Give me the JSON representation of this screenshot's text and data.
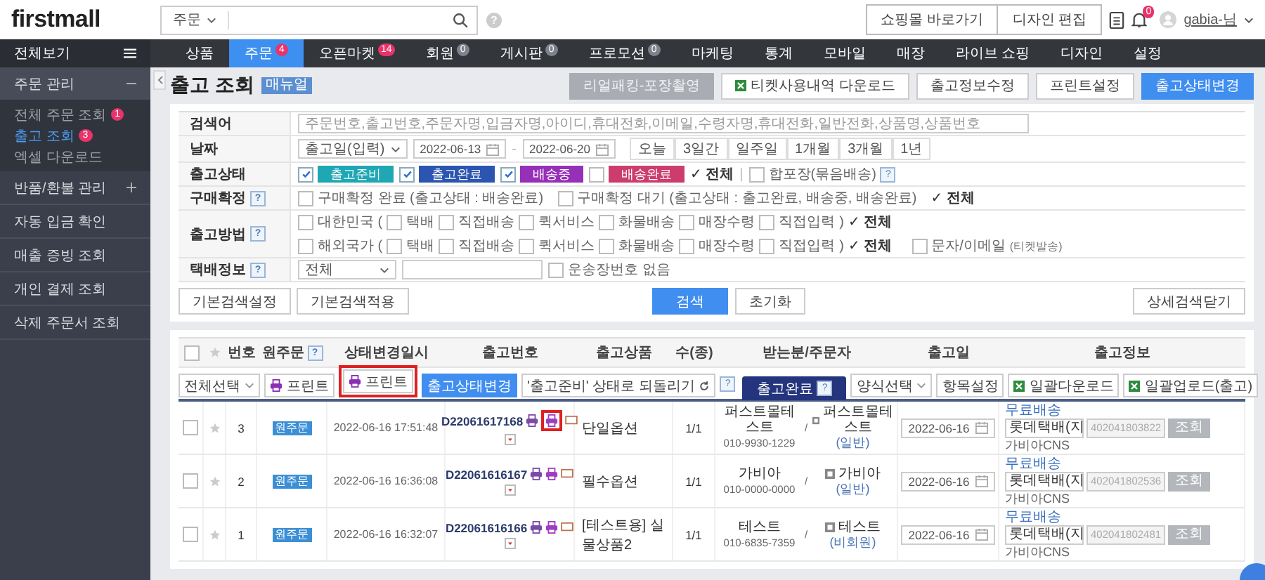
{
  "header": {
    "logo": "firstmall",
    "search_scope": "주문",
    "search_help": "?",
    "links": [
      "쇼핑몰 바로가기",
      "디자인 편집"
    ],
    "notification_count": "0",
    "user": "gabia-님"
  },
  "nav": {
    "all_menu": "전체보기",
    "tabs": [
      {
        "label": "상품",
        "selected": false
      },
      {
        "label": "주문",
        "selected": true,
        "badge": {
          "text": "4",
          "color": "#e8336b"
        }
      },
      {
        "label": "오픈마켓",
        "selected": false,
        "badge": {
          "text": "14",
          "color": "#e8336b"
        }
      },
      {
        "label": "회원",
        "selected": false,
        "badge": {
          "text": "0",
          "color": "#7d828c"
        }
      },
      {
        "label": "게시판",
        "selected": false,
        "badge": {
          "text": "0",
          "color": "#7d828c"
        }
      },
      {
        "label": "프로모션",
        "selected": false,
        "badge": {
          "text": "0",
          "color": "#7d828c"
        }
      },
      {
        "label": "마케팅",
        "selected": false
      },
      {
        "label": "통계",
        "selected": false
      },
      {
        "label": "모바일",
        "selected": false
      },
      {
        "label": "매장",
        "selected": false
      },
      {
        "label": "라이브 쇼핑",
        "selected": false
      },
      {
        "label": "디자인",
        "selected": false
      },
      {
        "label": "설정",
        "selected": false
      }
    ]
  },
  "sidebar": {
    "sections": [
      {
        "kind": "group",
        "label": "주문 관리",
        "expanded": true,
        "children": [
          {
            "label": "전체 주문 조회",
            "badge": "1",
            "selected": false
          },
          {
            "label": "출고 조회",
            "badge": "3",
            "selected": true
          },
          {
            "label": "엑셀 다운로드",
            "selected": false
          }
        ]
      },
      {
        "kind": "group",
        "label": "반품/환불 관리",
        "expanded": false
      },
      {
        "kind": "link",
        "label": "자동 입금 확인"
      },
      {
        "kind": "link",
        "label": "매출 증빙 조회"
      },
      {
        "kind": "link",
        "label": "개인 결제 조회"
      },
      {
        "kind": "link",
        "label": "삭제 주문서 조회"
      }
    ]
  },
  "page": {
    "title": "출고 조회",
    "manual_badge": "매뉴얼",
    "actions": [
      {
        "label": "리얼패킹-포장촬영",
        "kind": "muted"
      },
      {
        "label": "티켓사용내역 다운로드",
        "kind": "excel"
      },
      {
        "label": "출고정보수정",
        "kind": "plain"
      },
      {
        "label": "프린트설정",
        "kind": "plain"
      },
      {
        "label": "출고상태변경",
        "kind": "primary"
      }
    ]
  },
  "search": {
    "rows": [
      {
        "kind": "keyword",
        "label": "검색어",
        "placeholder": "주문번호,출고번호,주문자명,입금자명,아이디,휴대전화,이메일,수령자명,휴대전화,일반전화,상품명,상품번호"
      },
      {
        "kind": "date",
        "label": "날짜",
        "date_type": "출고일(입력)",
        "from": "2022-06-13",
        "separator": "-",
        "to": "2022-06-20",
        "ranges": [
          "오늘",
          "3일간",
          "일주일",
          "1개월",
          "3개월",
          "1년"
        ]
      },
      {
        "kind": "status",
        "label": "출고상태",
        "statuses": [
          {
            "label": "출고준비",
            "checked": true,
            "color": "#1fa7b4"
          },
          {
            "label": "출고완료",
            "checked": true,
            "color": "#2b55b0"
          },
          {
            "label": "배송중",
            "checked": true,
            "color": "#9630b8"
          },
          {
            "label": "배송완료",
            "checked": false,
            "color": "#cc3d6e"
          }
        ],
        "all": "✓ 전체",
        "separator": "|",
        "bundle": {
          "label": "합포장(묶음배송)",
          "checked": false,
          "help": "?"
        }
      },
      {
        "kind": "options",
        "label": "구매확정",
        "help": "?",
        "options": [
          {
            "label": "구매확정 완료 (출고상태 : 배송완료)",
            "checked": false
          },
          {
            "label": "구매확정 대기 (출고상태 : 출고완료, 배송중, 배송완료)",
            "checked": false
          }
        ],
        "all": "✓ 전체"
      },
      {
        "kind": "method",
        "label": "출고방법",
        "help": "?",
        "groups": [
          {
            "label": "대한민국 (",
            "checked": false,
            "options": [
              {
                "label": "택배",
                "checked": false
              },
              {
                "label": "직접배송",
                "checked": false
              },
              {
                "label": "퀵서비스",
                "checked": false
              },
              {
                "label": "화물배송",
                "checked": false
              },
              {
                "label": "매장수령",
                "checked": false
              },
              {
                "label": "직접입력",
                "checked": false
              }
            ],
            "close": ")",
            "all": "✓ 전체"
          },
          {
            "label": "해외국가 (",
            "checked": false,
            "options": [
              {
                "label": "택배",
                "checked": false
              },
              {
                "label": "직접배송",
                "checked": false
              },
              {
                "label": "퀵서비스",
                "checked": false
              },
              {
                "label": "화물배송",
                "checked": false
              },
              {
                "label": "매장수령",
                "checked": false
              },
              {
                "label": "직접입력",
                "checked": false
              }
            ],
            "close": ")",
            "all": "✓ 전체"
          }
        ],
        "extra": {
          "label": "문자/이메일",
          "note": "(티켓발송)",
          "checked": false
        }
      },
      {
        "kind": "courier",
        "label": "택배정보",
        "help": "?",
        "select": "전체",
        "no_tracking": {
          "label": "운송장번호 없음",
          "checked": false
        }
      }
    ],
    "left_buttons": [
      "기본검색설정",
      "기본검색적용"
    ],
    "search_button": "검색",
    "reset_button": "초기화",
    "close_button": "상세검색닫기"
  },
  "orders": {
    "select_all_checked": false,
    "columns": [
      {
        "label": "번호"
      },
      {
        "label": "원주문",
        "help": "?"
      },
      {
        "label": "상태변경일시"
      },
      {
        "label": "출고번호"
      },
      {
        "label": "출고상품"
      },
      {
        "label": "수(종)"
      },
      {
        "label": "받는분/주문자"
      },
      {
        "label": "출고일"
      },
      {
        "label": "출고정보"
      }
    ],
    "toolbar": {
      "select": "전체선택",
      "buttons": [
        {
          "label": "프린트",
          "kind": "print",
          "highlighted": false
        },
        {
          "label": "프린트",
          "kind": "print",
          "highlighted": true
        },
        {
          "label": "출고상태변경",
          "kind": "primary",
          "highlighted": false
        },
        {
          "label": "'출고준비' 상태로 되돌리기",
          "kind": "revert",
          "highlighted": false
        }
      ],
      "help": "?",
      "tab": {
        "label": "출고완료",
        "help": "?"
      },
      "right_buttons": [
        {
          "label": "양식선택",
          "kind": "select"
        },
        {
          "label": "항목설정",
          "kind": "plain"
        },
        {
          "label": "일괄다운로드",
          "kind": "excel"
        },
        {
          "label": "일괄업로드(출고)",
          "kind": "excel"
        }
      ]
    },
    "rows": [
      {
        "checked": false,
        "starred": false,
        "number": "3",
        "origin": "원주문",
        "changed_at": "2022-06-16 17:51:48",
        "shipment_no": "D22061617168",
        "print_highlighted": true,
        "product": "단일옵션",
        "quantity": "1/1",
        "recipient": "퍼스트몰테스트",
        "recipient_phone": "010-9930-1229",
        "separator": "/",
        "orderer": "퍼스트몰테스트",
        "orderer_type": "(일반)",
        "ship_date": "2022-06-16",
        "delivery_fee": "무료배송",
        "carrier": "롯데택배(지",
        "tracking_no": "402041803822",
        "lookup": "조회",
        "company": "가비아CNS"
      },
      {
        "checked": false,
        "starred": false,
        "number": "2",
        "origin": "원주문",
        "changed_at": "2022-06-16 16:36:08",
        "shipment_no": "D22061616167",
        "print_highlighted": false,
        "product": "필수옵션",
        "quantity": "1/1",
        "recipient": "가비아",
        "recipient_phone": "010-0000-0000",
        "separator": "/",
        "orderer": "가비아",
        "orderer_type": "(일반)",
        "ship_date": "2022-06-16",
        "delivery_fee": "무료배송",
        "carrier": "롯데택배(지",
        "tracking_no": "402041802536",
        "lookup": "조회",
        "company": "가비아CNS"
      },
      {
        "checked": false,
        "starred": false,
        "number": "1",
        "origin": "원주문",
        "changed_at": "2022-06-16 16:32:07",
        "shipment_no": "D22061616166",
        "print_highlighted": false,
        "product": "[테스트용] 실물상품2",
        "quantity": "1/1",
        "recipient": "테스트",
        "recipient_phone": "010-6835-7359",
        "separator": "/",
        "orderer": "테스트",
        "orderer_type": "(비회원)",
        "ship_date": "2022-06-16",
        "delivery_fee": "무료배송",
        "carrier": "롯데택배(지",
        "tracking_no": "402041802481",
        "lookup": "조회",
        "company": "가비아CNS"
      }
    ]
  }
}
